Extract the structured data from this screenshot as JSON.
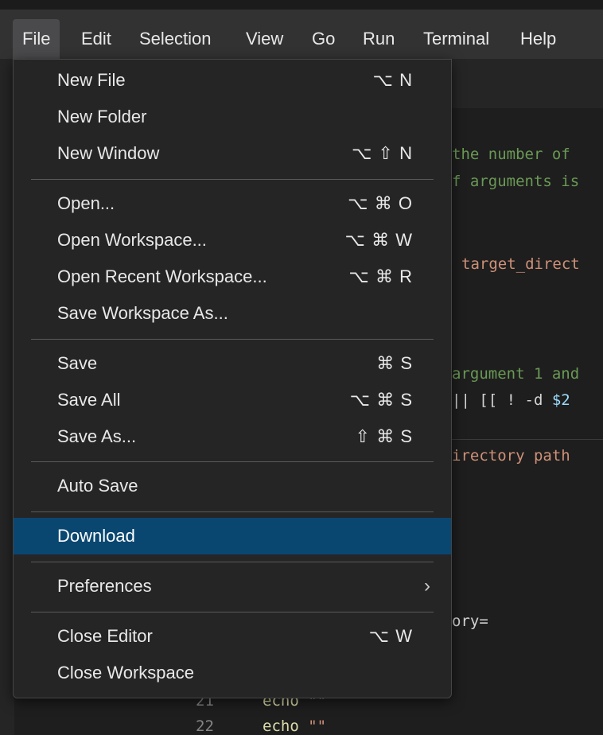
{
  "menubar": {
    "items": [
      "File",
      "Edit",
      "Selection",
      "View",
      "Go",
      "Run",
      "Terminal",
      "Help"
    ]
  },
  "file_menu": {
    "groups": [
      [
        {
          "label": "New File",
          "shortcut": "⌥ N"
        },
        {
          "label": "New Folder",
          "shortcut": ""
        },
        {
          "label": "New Window",
          "shortcut": "⌥ ⇧ N"
        }
      ],
      [
        {
          "label": "Open...",
          "shortcut": "⌥ ⌘ O"
        },
        {
          "label": "Open Workspace...",
          "shortcut": "⌥ ⌘ W"
        },
        {
          "label": "Open Recent Workspace...",
          "shortcut": "⌥ ⌘ R"
        },
        {
          "label": "Save Workspace As...",
          "shortcut": ""
        }
      ],
      [
        {
          "label": "Save",
          "shortcut": "⌘ S"
        },
        {
          "label": "Save All",
          "shortcut": "⌥ ⌘ S"
        },
        {
          "label": "Save As...",
          "shortcut": "⇧ ⌘ S"
        }
      ],
      [
        {
          "label": "Auto Save",
          "shortcut": ""
        }
      ],
      [
        {
          "label": "Download",
          "shortcut": "",
          "active": true
        }
      ],
      [
        {
          "label": "Preferences",
          "shortcut": "",
          "submenu": true
        }
      ],
      [
        {
          "label": "Close Editor",
          "shortcut": "⌥ W"
        },
        {
          "label": "Close Workspace",
          "shortcut": ""
        }
      ]
    ],
    "submenu_glyph": "›"
  },
  "editor": {
    "fragments": {
      "c1": "the number of",
      "c2": "f arguments is",
      "s1": "target_direct",
      "c3": "argument 1 and",
      "p1": "|| [[ ! -d ",
      "v1": "$2",
      "s2": "irectory path",
      "p2": "ory=",
      "ln21": "21",
      "ln22": "22",
      "e21": "echo",
      "q21": "\"\"",
      "e22": "echo",
      "q22": "\"\""
    }
  },
  "colors": {
    "menu_bg": "#252526",
    "menu_active": "#094771",
    "menubar_bg": "#323233",
    "comment": "#6a9955",
    "string": "#ce9178"
  }
}
